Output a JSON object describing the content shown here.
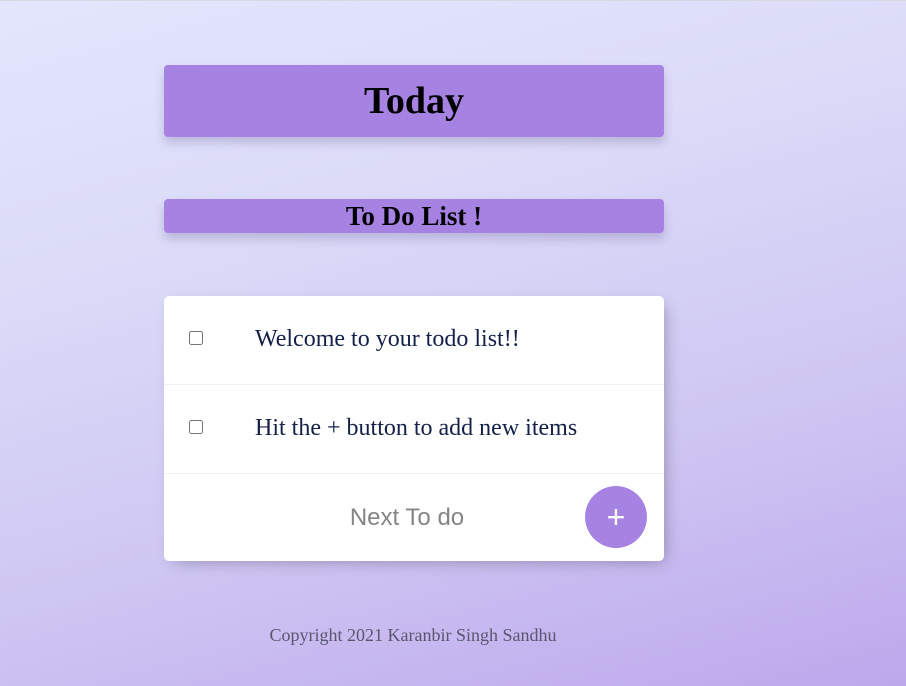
{
  "heading": {
    "day": "Today"
  },
  "list_title": "To Do List !",
  "todo_items": [
    {
      "text": "Welcome to your todo list!!",
      "checked": false
    },
    {
      "text": "Hit the + button to add new items",
      "checked": false
    }
  ],
  "add_form": {
    "placeholder": "Next To do",
    "value": "",
    "button_label": "+"
  },
  "footer": {
    "copyright": "Copyright 2021 Karanbir Singh Sandhu"
  },
  "colors": {
    "accent": "#a683e3",
    "item_text": "#142048",
    "background_top": "#e3e6fd",
    "background_bottom": "#bda8ec"
  }
}
